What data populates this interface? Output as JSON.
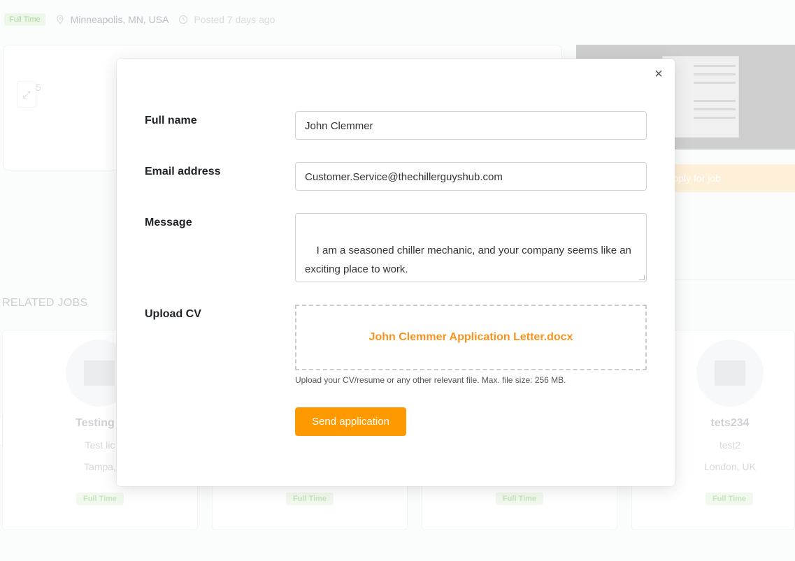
{
  "background": {
    "job_type_badge": "Full Time",
    "location": "Minneapolis, MN, USA",
    "posted": "Posted 7 days ago",
    "expand_num": "5",
    "apply_label": "Apply for job",
    "related_title": "RELATED JOBS",
    "related_cards": [
      {
        "title": "Testing g",
        "sub": "Test lic",
        "loc": "Tampa,",
        "tag": "Full Time"
      },
      {
        "title": "",
        "sub": "",
        "loc": "",
        "tag": "Full Time"
      },
      {
        "title": "",
        "sub": "",
        "loc": "",
        "tag": "Full Time"
      },
      {
        "title": "tets234",
        "sub": "test2",
        "loc": "London, UK",
        "tag": "Full Time"
      }
    ]
  },
  "modal": {
    "close_icon": "×",
    "full_name_label": "Full name",
    "full_name_value": "John Clemmer",
    "email_label": "Email address",
    "email_value": "Customer.Service@thechillerguyshub.com",
    "message_label": "Message",
    "message_value": "I am a seasoned chiller mechanic, and your company seems like an exciting place to work.\nPlease see the attached CV, and let me know if i would be a good fit.",
    "upload_label": "Upload CV",
    "uploaded_file": "John Clemmer Application Letter.docx",
    "upload_hint": "Upload your CV/resume or any other relevant file. Max. file size: 256 MB.",
    "send_button": "Send application"
  },
  "colors": {
    "accent": "#ff9900",
    "file_name": "#f7931e",
    "badge_bg": "#e3f3dd"
  }
}
